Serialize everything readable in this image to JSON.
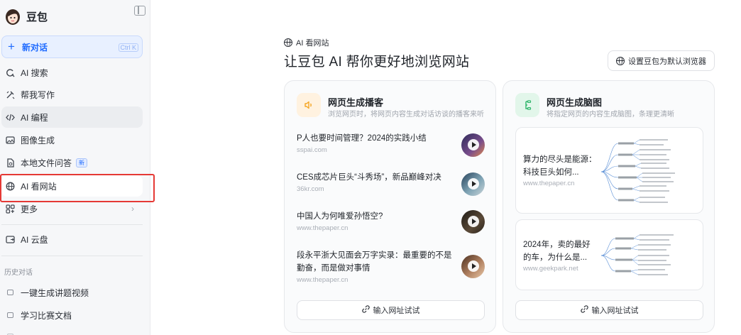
{
  "sidebar": {
    "brand": "豆包",
    "new_chat": {
      "label": "新对话",
      "shortcut": "Ctrl K"
    },
    "items": [
      {
        "label": "AI 搜索",
        "icon": "search-icon"
      },
      {
        "label": "帮我写作",
        "icon": "pen-icon"
      },
      {
        "label": "AI 编程",
        "icon": "code-icon"
      },
      {
        "label": "图像生成",
        "icon": "image-icon"
      },
      {
        "label": "本地文件问答",
        "icon": "file-icon",
        "badge": "新"
      },
      {
        "label": "AI 看网站",
        "icon": "globe-icon"
      },
      {
        "label": "更多",
        "icon": "grid-icon"
      },
      {
        "label": "AI 云盘",
        "icon": "cloud-drive-icon"
      }
    ],
    "history_title": "历史对话",
    "history": [
      {
        "label": "一键生成讲题视频"
      },
      {
        "label": "学习比赛文档"
      }
    ]
  },
  "main": {
    "kicker": "AI 看网站",
    "title": "让豆包 AI 帮你更好地浏览网站",
    "default_browser_button": "设置豆包为默认浏览器",
    "podcast_card": {
      "title": "网页生成播客",
      "subtitle": "浏览网页时，将网页内容生成对话访谈的播客来听",
      "items": [
        {
          "title": "P人也要时间管理？2024的实践小结",
          "source": "sspai.com"
        },
        {
          "title": "CES成芯片巨头“斗秀场”，新品巅峰对决",
          "source": "36kr.com"
        },
        {
          "title": "中国人为何唯爱孙悟空?",
          "source": "www.thepaper.cn"
        },
        {
          "title": "段永平浙大见面会万字实录：最重要的不是勤奋，而是做对事情",
          "source": "www.thepaper.cn"
        }
      ],
      "try_button": "输入网址试试"
    },
    "mindmap_card": {
      "title": "网页生成脑图",
      "subtitle": "将指定网页的内容生成脑图，条理更清晰",
      "items": [
        {
          "title": "算力的尽头是能源：科技巨头如何...",
          "source": "www.thepaper.cn"
        },
        {
          "title": "2024年，卖的最好的车，为什么是...",
          "source": "www.geekpark.net"
        }
      ],
      "try_button": "输入网址试试"
    }
  },
  "colors": {
    "accent": "#1f6bff",
    "highlight_box": "#e53935",
    "podcast_icon_bg": "#fff2e0",
    "mindmap_icon_bg": "#e2f6ea"
  }
}
